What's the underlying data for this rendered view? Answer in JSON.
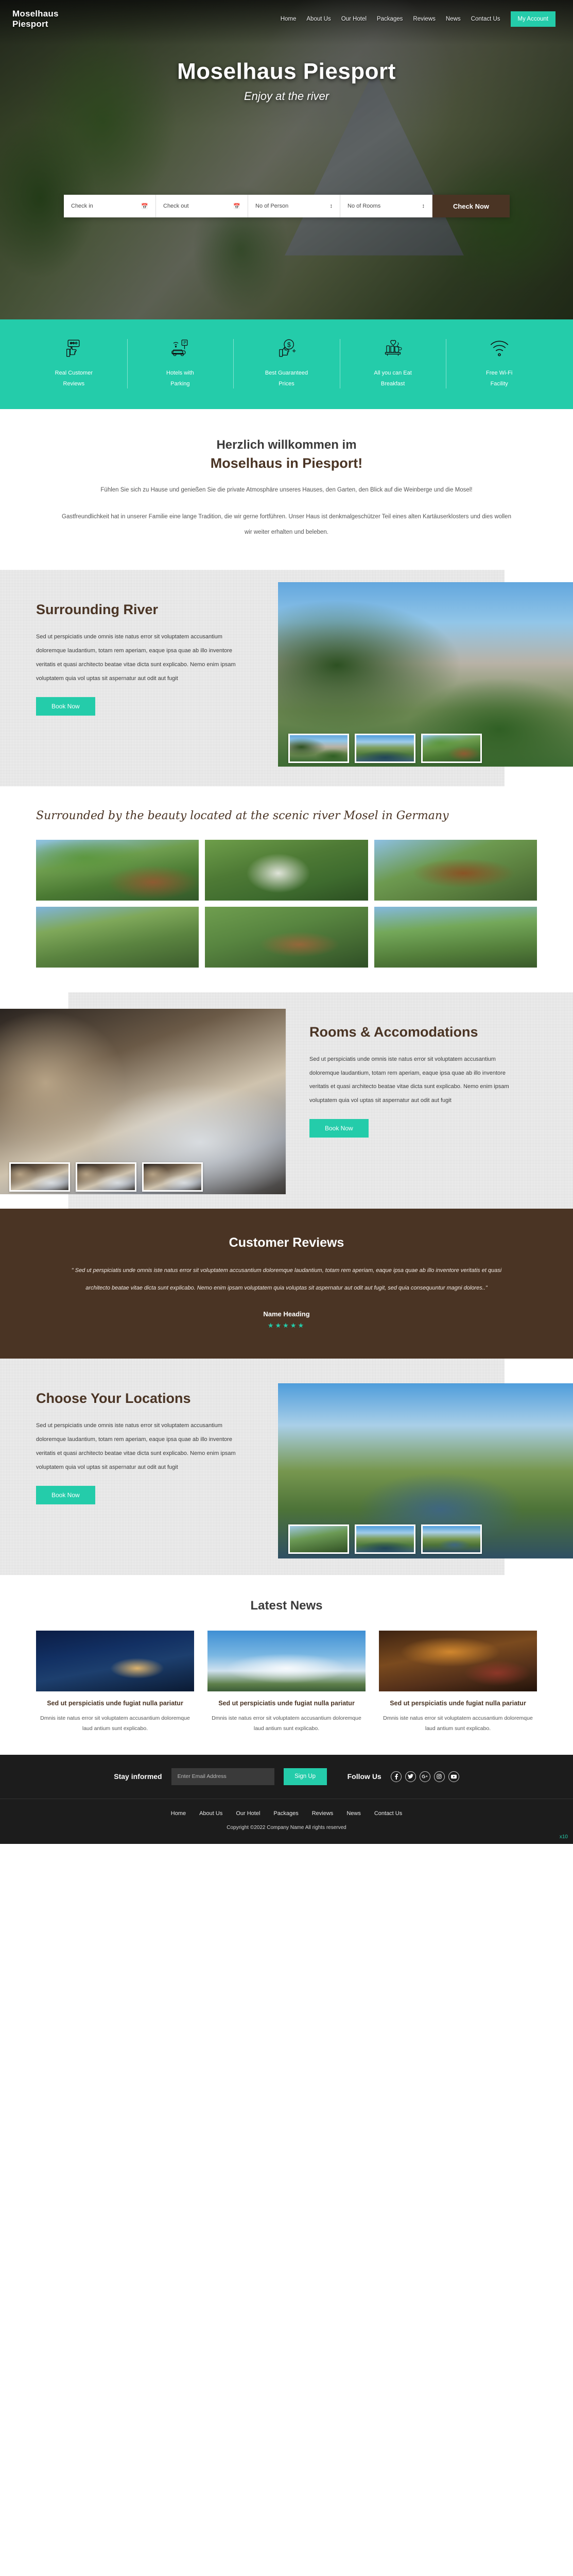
{
  "header": {
    "brand_line1": "Moselhaus",
    "brand_line2": "Piesport",
    "nav": [
      {
        "label": "Home"
      },
      {
        "label": "About Us"
      },
      {
        "label": "Our Hotel"
      },
      {
        "label": "Packages"
      },
      {
        "label": "Reviews"
      },
      {
        "label": "News"
      },
      {
        "label": "Contact Us"
      }
    ],
    "account_button": "My Account"
  },
  "hero": {
    "title": "Moselhaus Piesport",
    "subtitle": "Enjoy at the river",
    "booking": {
      "checkin": "Check in",
      "checkout": "Check out",
      "persons": "No of Person",
      "rooms": "No of Rooms",
      "submit": "Check Now"
    }
  },
  "features": [
    {
      "icon": "review-thumbsup-icon",
      "line1": "Real Customer",
      "line2": "Reviews"
    },
    {
      "icon": "car-parking-icon",
      "line1": "Hotels with",
      "line2": "Parking"
    },
    {
      "icon": "best-price-icon",
      "line1": "Best Guaranteed",
      "line2": "Prices"
    },
    {
      "icon": "breakfast-icon",
      "line1": "All you can Eat",
      "line2": "Breakfast"
    },
    {
      "icon": "wifi-icon",
      "line1": "Free Wi-Fi",
      "line2": "Facility"
    }
  ],
  "welcome": {
    "heading_top": "Herzlich willkommen im",
    "heading_main": "Moselhaus in Piesport!",
    "para1": "Fühlen Sie sich zu Hause und genießen Sie die private Atmosphäre unseres Hauses, den Garten, den Blick auf die Weinberge und die Mosel!",
    "para2": "Gastfreundlichkeit hat in unserer Familie eine lange Tradition, die wir gerne fortführen. Unser Haus ist denkmalgeschützer Teil eines alten Kartäuserklosters und dies wollen wir weiter erhalten und beleben."
  },
  "body_copy": "Sed ut perspiciatis unde omnis iste natus error sit voluptatem accusantium doloremque laudantium, totam rem aperiam, eaque ipsa quae ab illo inventore veritatis et quasi architecto beatae vitae dicta sunt explicabo. Nemo enim ipsam voluptatem quia vol uptas sit aspernatur aut odit aut fugit",
  "book_now": "Book Now",
  "sections": {
    "river": {
      "title": "Surrounding River"
    },
    "rooms": {
      "title": "Rooms & Accomodations"
    },
    "locations": {
      "title": "Choose Your Locations"
    }
  },
  "gallery": {
    "heading": "Surrounded by the beauty located at the scenic river Mosel in Germany",
    "images": [
      {
        "name": "garden-lounge"
      },
      {
        "name": "statue-path"
      },
      {
        "name": "moselhaus-sign"
      },
      {
        "name": "vineyard-view"
      },
      {
        "name": "terrace-umbrella"
      },
      {
        "name": "garden-wall"
      }
    ]
  },
  "reviews": {
    "title": "Customer Reviews",
    "quote": "\" Sed ut perspiciatis unde omnis iste natus error sit voluptatem accusantium doloremque laudantium, totam rem aperiam, eaque ipsa quae ab illo inventore veritatis et quasi architecto beatae vitae dicta sunt explicabo. Nemo enim ipsam voluptatem quia voluptas sit aspernatur aut odit aut fugit, sed quia consequuntur magni dolores..\"",
    "name": "Name Heading",
    "stars": "★★★★★",
    "star_color": "#24ccaa"
  },
  "news": {
    "title": "Latest News",
    "items": [
      {
        "image": "night-terrace",
        "title": "Sed ut perspiciatis unde fugiat nulla pariatur",
        "text": "Dmnis iste natus error sit voluptatem accusantium doloremque laud antium sunt explicabo."
      },
      {
        "image": "mosel-valley-sky",
        "title": "Sed ut perspiciatis unde fugiat nulla pariatur",
        "text": "Dmnis iste natus error sit voluptatem accusantium doloremque laud antium sunt explicabo."
      },
      {
        "image": "wine-cellar",
        "title": "Sed ut perspiciatis unde fugiat nulla pariatur",
        "text": "Dmnis iste natus error sit voluptatem accusantium doloremque laud antium sunt explicabo."
      }
    ]
  },
  "footer": {
    "stay_label": "Stay informed",
    "email_placeholder": "Enter Email Address",
    "signup_button": "Sign Up",
    "follow_label": "Follow Us",
    "social": [
      {
        "name": "facebook-icon",
        "glyph": "f"
      },
      {
        "name": "twitter-icon",
        "glyph": "✦"
      },
      {
        "name": "google-plus-icon",
        "glyph": "g"
      },
      {
        "name": "instagram-icon",
        "glyph": "◉"
      },
      {
        "name": "youtube-icon",
        "glyph": "▸"
      }
    ],
    "nav": [
      {
        "label": "Home"
      },
      {
        "label": "About Us"
      },
      {
        "label": "Our Hotel"
      },
      {
        "label": "Packages"
      },
      {
        "label": "Reviews"
      },
      {
        "label": "News"
      },
      {
        "label": "Contact Us"
      }
    ],
    "copyright": "Copyright ©2022 Company Name  All rights reserved",
    "zoom_marker": "x10"
  },
  "colors": {
    "accent_teal": "#24ccaa",
    "brand_brown": "#4a3424",
    "footer_dark": "#1c1c1c"
  }
}
